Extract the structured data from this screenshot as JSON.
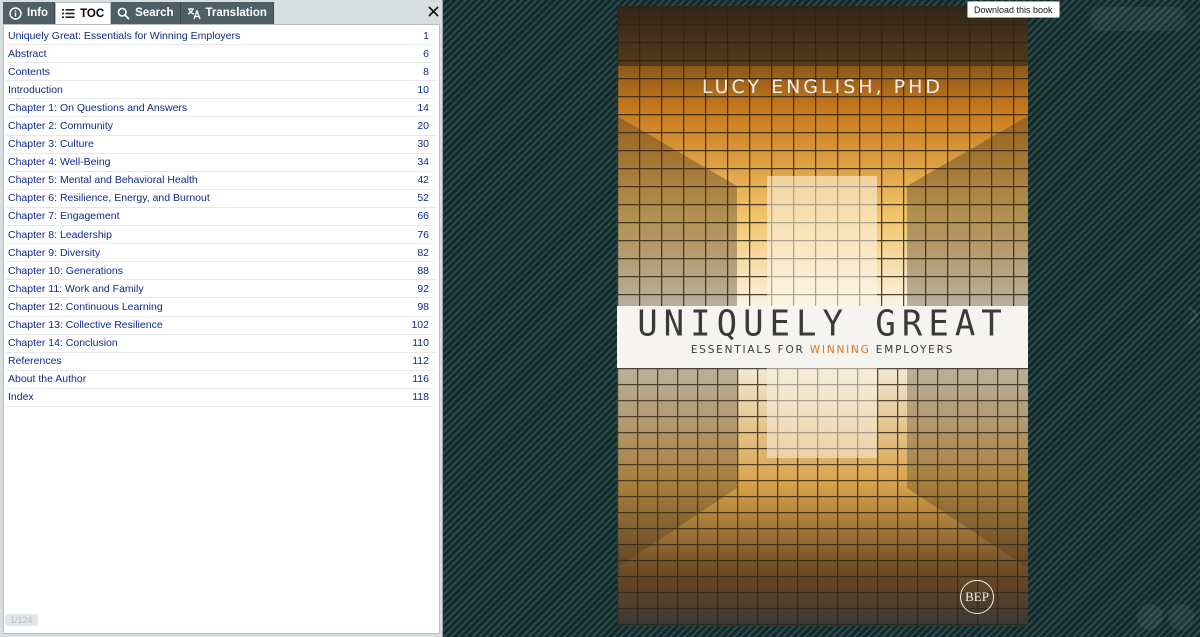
{
  "tabs": [
    {
      "label": "Info",
      "icon": "info-icon"
    },
    {
      "label": "TOC",
      "icon": "list-icon",
      "active": true
    },
    {
      "label": "Search",
      "icon": "search-icon"
    },
    {
      "label": "Translation",
      "icon": "translate-icon"
    }
  ],
  "toc": [
    {
      "title": "Uniquely Great: Essentials for Winning Employers",
      "page": "1"
    },
    {
      "title": "Abstract",
      "page": "6"
    },
    {
      "title": "Contents",
      "page": "8"
    },
    {
      "title": "Introduction",
      "page": "10"
    },
    {
      "title": "Chapter 1: On Questions and Answers",
      "page": "14"
    },
    {
      "title": "Chapter 2: Community",
      "page": "20"
    },
    {
      "title": "Chapter 3: Culture",
      "page": "30"
    },
    {
      "title": "Chapter 4: Well-Being",
      "page": "34"
    },
    {
      "title": "Chapter 5: Mental and Behavioral Health",
      "page": "42"
    },
    {
      "title": "Chapter 6: Resilience, Energy, and Burnout",
      "page": "52"
    },
    {
      "title": "Chapter 7: Engagement",
      "page": "66"
    },
    {
      "title": "Chapter 8: Leadership",
      "page": "76"
    },
    {
      "title": "Chapter 9: Diversity",
      "page": "82"
    },
    {
      "title": "Chapter 10: Generations",
      "page": "88"
    },
    {
      "title": "Chapter 11: Work and Family",
      "page": "92"
    },
    {
      "title": "Chapter 12: Continuous Learning",
      "page": "98"
    },
    {
      "title": "Chapter 13: Collective Resilience",
      "page": "102"
    },
    {
      "title": "Chapter 14: Conclusion",
      "page": "110"
    },
    {
      "title": "References",
      "page": "112"
    },
    {
      "title": "About the Author",
      "page": "116"
    },
    {
      "title": "Index",
      "page": "118"
    }
  ],
  "page_indicator": "1/124",
  "tooltip": "Download this book",
  "cover": {
    "author": "LUCY ENGLISH, PHD",
    "title": "UNIQUELY GREAT",
    "subtitle_pre": "ESSENTIALS FOR ",
    "subtitle_accent": "WINNING",
    "subtitle_post": " EMPLOYERS",
    "publisher": "BEP"
  },
  "colors": {
    "tab_bg": "#4f5f68",
    "link": "#0f2a8a",
    "accent": "#d9731f",
    "viewer_bg": "#1d3838"
  }
}
